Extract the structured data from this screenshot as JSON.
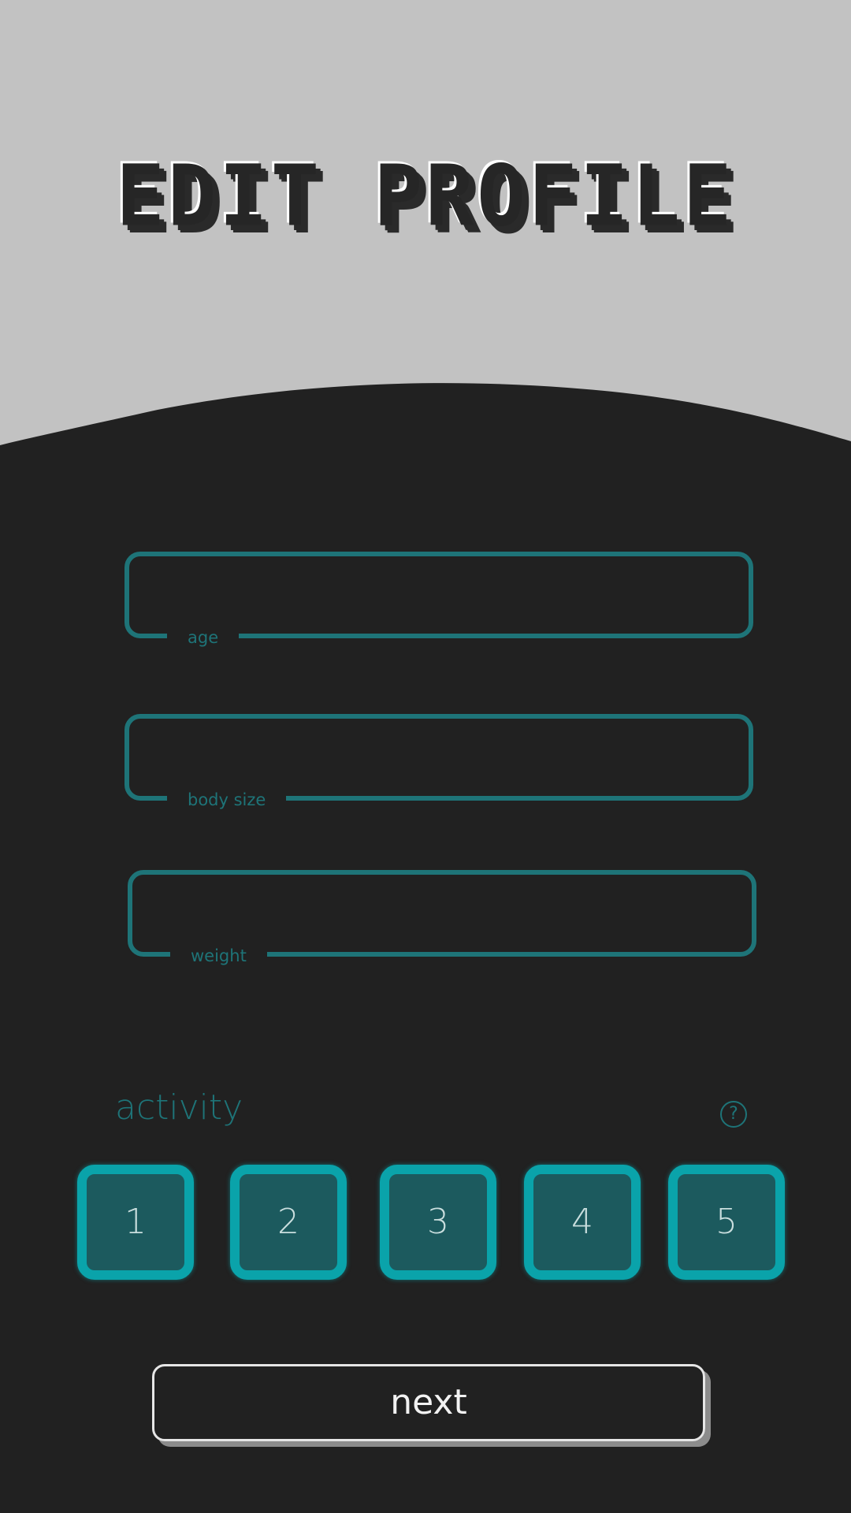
{
  "header": {
    "title": "EDIT PROFILE"
  },
  "form": {
    "fields": [
      {
        "label": "age",
        "value": ""
      },
      {
        "label": "body size",
        "value": ""
      },
      {
        "label": "weight",
        "value": ""
      }
    ]
  },
  "activity": {
    "label": "activity",
    "help_symbol": "?",
    "help_icon": "question-circle-icon",
    "levels": [
      "1",
      "2",
      "3",
      "4",
      "5"
    ]
  },
  "actions": {
    "next_label": "next"
  },
  "colors": {
    "background": "#212121",
    "header": "#c2c2c2",
    "accent": "#1e7478",
    "button_fill": "#1c5a5e",
    "button_border": "#0aa3aa"
  }
}
